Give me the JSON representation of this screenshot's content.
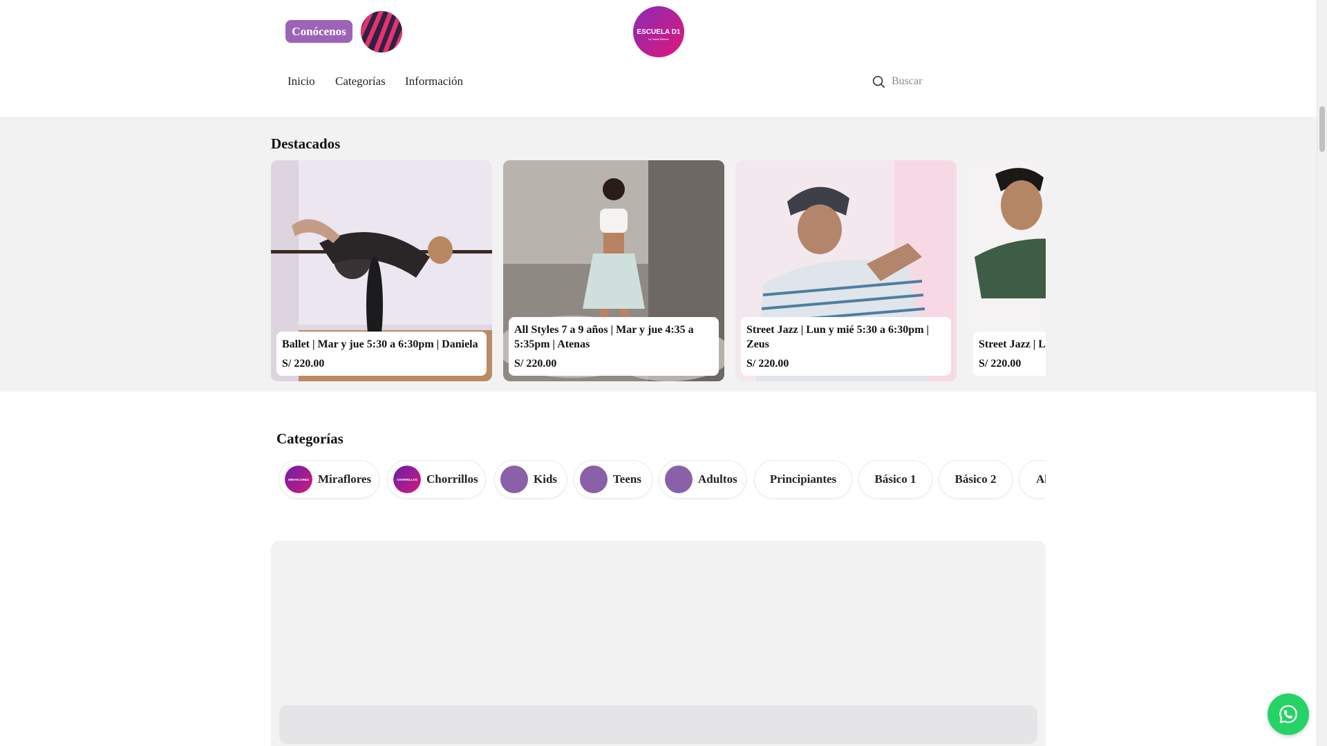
{
  "header": {
    "about_button": "Conócenos",
    "brand_logo_text": "ESCUELA D1",
    "brand_logo_subtext": "by Vania Masías"
  },
  "nav": {
    "items": [
      {
        "label": "Inicio"
      },
      {
        "label": "Categorías"
      },
      {
        "label": "Información"
      }
    ],
    "search_placeholder": "Buscar"
  },
  "featured": {
    "title": "Destacados",
    "cards": [
      {
        "title": "Ballet | Mar y jue 5:30 a 6:30pm | Daniela",
        "price": "S/ 220.00"
      },
      {
        "title": "All Styles 7 a 9 años | Mar y jue 4:35 a 5:35pm | Atenas",
        "price": "S/ 220.00"
      },
      {
        "title": "Street Jazz | Lun y mié 5:30 a 6:30pm | Zeus",
        "price": "S/ 220.00"
      },
      {
        "title": "Street Jazz | L… Jordy",
        "price": "S/ 220.00"
      }
    ]
  },
  "categories": {
    "title": "Categorías",
    "chips": [
      {
        "label": "Miraflores",
        "avatar_text": "MIRAFLORES"
      },
      {
        "label": "Chorrillos",
        "avatar_text": "CHORRILLOS"
      },
      {
        "label": "Kids"
      },
      {
        "label": "Teens"
      },
      {
        "label": "Adultos"
      },
      {
        "label": "Principiantes"
      },
      {
        "label": "Básico 1"
      },
      {
        "label": "Básico 2"
      },
      {
        "label": "Al"
      }
    ]
  },
  "colors": {
    "accent": "#9d63b7",
    "brand_magenta": "#d0197e",
    "avatar_purple": "#8a60a8",
    "whatsapp": "#25d366"
  }
}
